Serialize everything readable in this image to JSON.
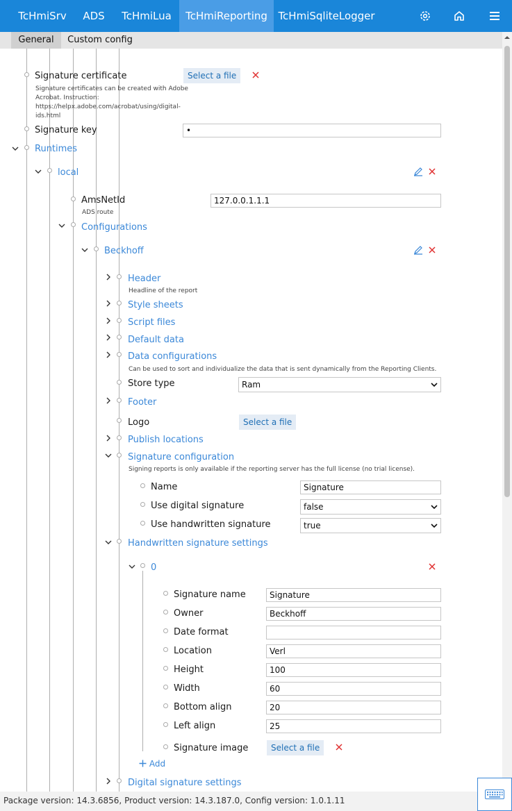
{
  "nav": {
    "tabs": [
      {
        "label": "TcHmiSrv"
      },
      {
        "label": "ADS"
      },
      {
        "label": "TcHmiLua"
      },
      {
        "label": "TcHmiReporting"
      },
      {
        "label": "TcHmiSqliteLogger"
      }
    ],
    "active_tab": "TcHmiReporting",
    "icons": [
      "gear-icon",
      "home-icon",
      "hamburger-menu-icon"
    ]
  },
  "subtabs": [
    {
      "label": "General"
    },
    {
      "label": "Custom config"
    }
  ],
  "tree": {
    "signature_certificate": {
      "label": "Signature certificate",
      "desc_1": "Signature certificates can be created with Adobe",
      "desc_2": "Acrobat. Instruction:",
      "desc_3": "https://helpx.adobe.com/acrobat/using/digital-",
      "desc_4": "ids.html",
      "button": "Select a file"
    },
    "signature_key": {
      "label": "Signature key",
      "value": "•"
    },
    "runtimes": {
      "label": "Runtimes"
    },
    "local": {
      "label": "local"
    },
    "ams_net_id": {
      "label": "AmsNetId",
      "desc": "ADS route",
      "value": "127.0.0.1.1.1"
    },
    "configurations": {
      "label": "Configurations"
    },
    "beckhoff": {
      "label": "Beckhoff"
    },
    "header": {
      "label": "Header",
      "desc": "Headline of the report"
    },
    "style_sheets": {
      "label": "Style sheets"
    },
    "script_files": {
      "label": "Script files"
    },
    "default_data": {
      "label": "Default data"
    },
    "data_configurations": {
      "label": "Data configurations",
      "desc": "Can be used to sort and individualize the data that is sent dynamically from the Reporting Clients."
    },
    "store_type": {
      "label": "Store type",
      "value": "Ram"
    },
    "footer": {
      "label": "Footer"
    },
    "logo": {
      "label": "Logo",
      "button": "Select a file"
    },
    "publish_locations": {
      "label": "Publish locations"
    },
    "signature_configuration": {
      "label": "Signature configuration",
      "desc": "Signing reports is only available if the reporting server has the full license (no trial license)."
    },
    "sig_name": {
      "label": "Name",
      "value": "Signature"
    },
    "use_digital_signature": {
      "label": "Use digital signature",
      "value": "false"
    },
    "use_handwritten_signature": {
      "label": "Use handwritten signature",
      "value": "true"
    },
    "handwritten_signature_settings": {
      "label": "Handwritten signature settings"
    },
    "item_0": {
      "label": "0"
    },
    "hw_fields": [
      {
        "label": "Signature name",
        "value": "Signature"
      },
      {
        "label": "Owner",
        "value": "Beckhoff"
      },
      {
        "label": "Date format",
        "value": ""
      },
      {
        "label": "Location",
        "value": "Verl"
      },
      {
        "label": "Height",
        "value": "100"
      },
      {
        "label": "Width",
        "value": "60"
      },
      {
        "label": "Bottom align",
        "value": "20"
      },
      {
        "label": "Left align",
        "value": "25"
      }
    ],
    "signature_image": {
      "label": "Signature image",
      "button": "Select a file"
    },
    "add": {
      "label": "Add"
    },
    "digital_signature_settings": {
      "label": "Digital signature settings"
    }
  },
  "footer": {
    "text": "Package version: 14.3.6856, Product version: 14.3.187.0, Config version: 1.0.1.11"
  },
  "colors": {
    "accent": "#1a86d9",
    "group_label": "#3b88d8",
    "delete": "#e03030"
  }
}
